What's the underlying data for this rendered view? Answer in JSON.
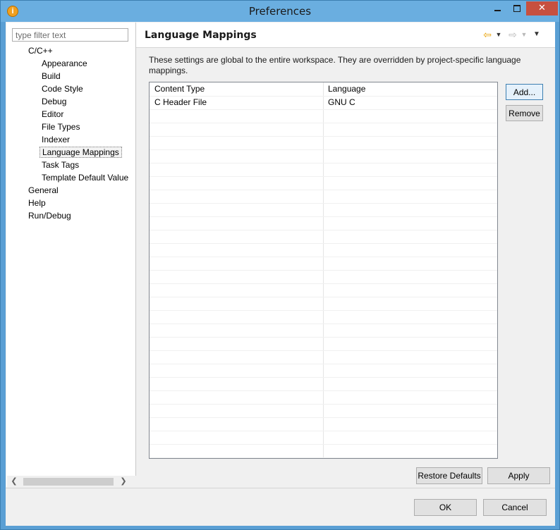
{
  "window": {
    "title": "Preferences",
    "app_icon": "eclipse-icon"
  },
  "filter": {
    "placeholder": "type filter text",
    "value": ""
  },
  "tree": {
    "items": [
      {
        "label": "C/C++",
        "level": 0
      },
      {
        "label": "Appearance",
        "level": 1
      },
      {
        "label": "Build",
        "level": 1
      },
      {
        "label": "Code Style",
        "level": 1
      },
      {
        "label": "Debug",
        "level": 1
      },
      {
        "label": "Editor",
        "level": 1
      },
      {
        "label": "File Types",
        "level": 1
      },
      {
        "label": "Indexer",
        "level": 1
      },
      {
        "label": "Language Mappings",
        "level": 1,
        "selected": true
      },
      {
        "label": "Task Tags",
        "level": 1
      },
      {
        "label": "Template Default Value",
        "level": 1
      },
      {
        "label": "General",
        "level": 0
      },
      {
        "label": "Help",
        "level": 0
      },
      {
        "label": "Run/Debug",
        "level": 0
      }
    ]
  },
  "page": {
    "title": "Language Mappings",
    "description": "These settings are global to the entire workspace.  They are overridden by project-specific language mappings."
  },
  "table": {
    "columns": [
      "Content Type",
      "Language"
    ],
    "rows": [
      [
        "C Header File",
        "GNU C"
      ]
    ]
  },
  "buttons": {
    "add": "Add...",
    "remove": "Remove",
    "restore_defaults": "Restore Defaults",
    "apply": "Apply",
    "ok": "OK",
    "cancel": "Cancel"
  },
  "icons": {
    "back": "back-arrow-icon",
    "forward": "forward-arrow-icon",
    "menu": "view-menu-icon"
  },
  "colors": {
    "titlebar": "#6aaee0",
    "close_button": "#c7503f",
    "nav_back": "#e8a000"
  }
}
